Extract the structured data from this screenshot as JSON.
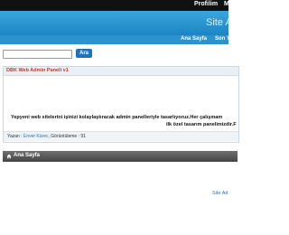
{
  "topbar": {
    "profile_label": "Profilim",
    "second_label": "M"
  },
  "header": {
    "site_title": "Site A"
  },
  "nav": {
    "items": [
      "Ana Sayfa",
      "Son Y"
    ]
  },
  "search": {
    "value": "",
    "placeholder": "",
    "button_label": "Ara"
  },
  "post": {
    "title": "DBK Web Admin Paneli v1",
    "body_line1": "Yepyeni web sitelerini işinizi kolaylaştıracak admin panelleriyle tasarlıyoruz.Her çalışmam",
    "body_line2": "ilk özel tasarım panelimizdir.F",
    "footer_prefix": "Yazan : ",
    "author": "Enver Kürec",
    "footer_suffix": ", Görüntüleme : 91"
  },
  "breadcrumb": {
    "icon": "home-icon",
    "label": "Ana Sayfa"
  },
  "footer": {
    "link_label": "Site Ad"
  },
  "colors": {
    "topbar": "#111111",
    "banner": "#2c93cf",
    "accent_button": "#1e73be",
    "post_title": "#c0392b",
    "breadcrumb": "#555555"
  }
}
